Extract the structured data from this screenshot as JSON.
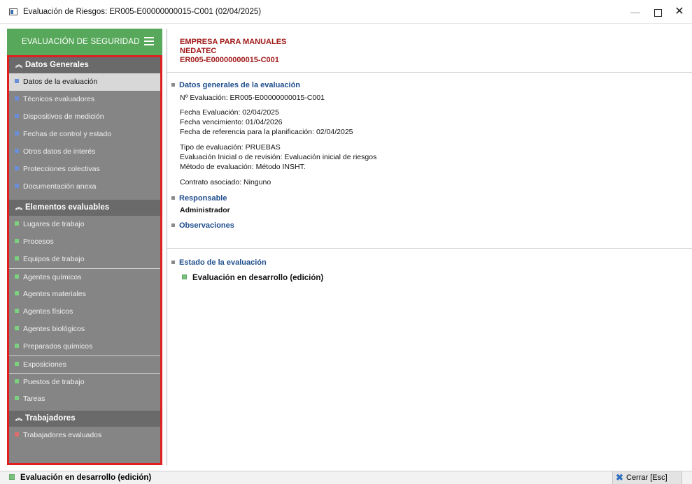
{
  "window": {
    "title": "Evaluación de Riesgos: ER005-E00000000015-C001  (02/04/2025)",
    "min_glyph": "—",
    "close_glyph": "✕"
  },
  "sidebar": {
    "header_label": "EVALUACIÓN DE SEGURIDAD",
    "sections": [
      {
        "title": "Datos Generales",
        "items": [
          {
            "label": "Datos de la evaluación",
            "color": "#6b8fd6",
            "selected": true
          },
          {
            "label": "Técnicos evaluadores",
            "color": "#6b8fd6"
          },
          {
            "label": "Dispositivos de medición",
            "color": "#6b8fd6"
          },
          {
            "label": "Fechas de control y estado",
            "color": "#6b8fd6"
          },
          {
            "label": "Otros datos de interés",
            "color": "#6b8fd6"
          },
          {
            "label": "Protecciones colectivas",
            "color": "#6b8fd6"
          },
          {
            "label": "Documentación anexa",
            "color": "#6b8fd6"
          }
        ]
      },
      {
        "title": "Elementos evaluables",
        "items": [
          {
            "label": "Lugares de trabajo",
            "color": "#7cd07f"
          },
          {
            "label": "Procesos",
            "color": "#7cd07f"
          },
          {
            "label": "Equipos de trabajo",
            "color": "#7cd07f"
          },
          {
            "label": "Agentes químicos",
            "color": "#7cd07f"
          },
          {
            "label": "Agentes materiales",
            "color": "#7cd07f"
          },
          {
            "label": "Agentes físicos",
            "color": "#7cd07f"
          },
          {
            "label": "Agentes biológicos",
            "color": "#7cd07f"
          },
          {
            "label": "Preparados químicos",
            "color": "#7cd07f"
          },
          {
            "label": "Exposiciones",
            "color": "#7cd07f"
          },
          {
            "label": "Puestos de trabajo",
            "color": "#7cd07f"
          },
          {
            "label": "Tareas",
            "color": "#7cd07f"
          }
        ]
      },
      {
        "title": "Trabajadores",
        "items": [
          {
            "label": "Trabajadores evaluados",
            "color": "#e06b6b"
          }
        ]
      }
    ]
  },
  "main": {
    "company": [
      "EMPRESA PARA MANUALES",
      "NEDATEC",
      "ER005-E00000000015-C001"
    ],
    "datos_generales": {
      "title": "Datos generales de la evaluación",
      "lines": [
        "Nº Evaluación: ER005-E00000000015-C001",
        "Fecha Evaluación: 02/04/2025",
        "Fecha vencimiento: 01/04/2026",
        "Fecha de referencia para la planificación: 02/04/2025",
        "Tipo de evaluación: PRUEBAS",
        "Evaluación Inicial o de revisión: Evaluación inicial de riesgos",
        "Método de evaluación: Método INSHT.",
        "Contrato asociado: Ninguno"
      ]
    },
    "responsable": {
      "title": "Responsable",
      "value": "Administrador"
    },
    "observaciones": {
      "title": "Observaciones"
    },
    "estado": {
      "title": "Estado de la evaluación",
      "value": "Evaluación en desarrollo (edición)"
    }
  },
  "statusbar": {
    "status": "Evaluación en desarrollo (edición)",
    "close_label": "Cerrar [Esc]"
  }
}
